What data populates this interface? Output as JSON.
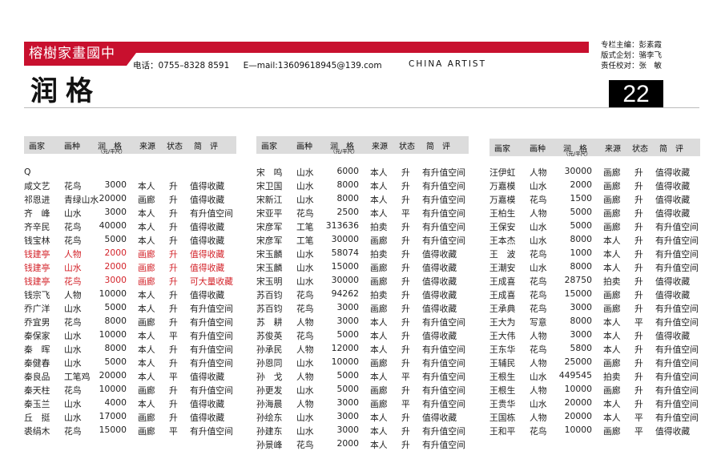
{
  "header": {
    "logo_text": "榕樹家畫國中",
    "phone": "电话：0755–8328 8591",
    "email": "E—mail:13609618945@139.com",
    "brand": "CHINA  ARTIST",
    "credits": [
      "专栏主编：彭素霞",
      "版式企划：骆李飞",
      "责任校对：张　敏"
    ],
    "title": "润格",
    "page_number": "22"
  },
  "table_header": {
    "artist": "画家",
    "genre": "画种",
    "price": "润　格",
    "unit": "（元/平尺）",
    "source": "来源",
    "status": "状态",
    "comment": "简　评"
  },
  "columns": [
    {
      "section": "Q",
      "rows": [
        [
          "咸文艺",
          "花鸟",
          "3000",
          "本人",
          "升",
          "值得收藏"
        ],
        [
          "祁恩进",
          "青绿山水",
          "20000",
          "画廊",
          "升",
          "值得收藏"
        ],
        [
          "齐　峰",
          "山水",
          "3000",
          "本人",
          "升",
          "有升值空间"
        ],
        [
          "齐辛民",
          "花鸟",
          "40000",
          "本人",
          "升",
          "值得收藏"
        ],
        [
          "钱宝林",
          "花鸟",
          "5000",
          "本人",
          "升",
          "值得收藏"
        ],
        [
          "钱建亭",
          "人物",
          "2000",
          "画廊",
          "升",
          "值得收藏",
          "red"
        ],
        [
          "钱建亭",
          "山水",
          "2000",
          "画廊",
          "升",
          "值得收藏",
          "red"
        ],
        [
          "钱建亭",
          "花鸟",
          "3000",
          "画廊",
          "升",
          "可大量收藏",
          "red"
        ],
        [
          "钱宗飞",
          "人物",
          "10000",
          "本人",
          "升",
          "值得收藏"
        ],
        [
          "乔广洋",
          "山水",
          "5000",
          "本人",
          "升",
          "有升值空间"
        ],
        [
          "乔宜男",
          "花鸟",
          "8000",
          "画廊",
          "升",
          "有升值空间"
        ],
        [
          "秦保家",
          "山水",
          "10000",
          "本人",
          "平",
          "有升值空间"
        ],
        [
          "秦　晖",
          "山水",
          "8000",
          "本人",
          "升",
          "有升值空间"
        ],
        [
          "秦健春",
          "山水",
          "5000",
          "本人",
          "升",
          "有升值空间"
        ],
        [
          "秦良品",
          "工笔鸡",
          "20000",
          "本人",
          "平",
          "值得收藏"
        ],
        [
          "秦天柱",
          "花鸟",
          "10000",
          "画廊",
          "升",
          "有升值空间"
        ],
        [
          "秦玉兰",
          "山水",
          "4000",
          "本人",
          "升",
          "值得收藏"
        ],
        [
          "丘　挺",
          "山水",
          "17000",
          "画廊",
          "升",
          "值得收藏"
        ],
        [
          "裘绢木",
          "花鸟",
          "15000",
          "画廊",
          "平",
          "有升值空间"
        ]
      ]
    },
    {
      "section": "",
      "rows": [
        [
          "宋　鸣",
          "山水",
          "6000",
          "本人",
          "升",
          "有升值空间"
        ],
        [
          "宋卫国",
          "山水",
          "8000",
          "本人",
          "升",
          "有升值空间"
        ],
        [
          "宋新江",
          "山水",
          "8000",
          "本人",
          "升",
          "有升值空间"
        ],
        [
          "宋亚平",
          "花鸟",
          "2500",
          "本人",
          "平",
          "有升值空间"
        ],
        [
          "宋彦军",
          "工笔",
          "313636",
          "拍卖",
          "升",
          "有升值空间"
        ],
        [
          "宋彦军",
          "工笔",
          "30000",
          "画廊",
          "升",
          "有升值空间"
        ],
        [
          "宋玉麟",
          "山水",
          "58074",
          "拍卖",
          "升",
          "值得收藏"
        ],
        [
          "宋玉麟",
          "山水",
          "15000",
          "画廊",
          "升",
          "值得收藏"
        ],
        [
          "宋玉明",
          "山水",
          "30000",
          "画廊",
          "升",
          "值得收藏"
        ],
        [
          "苏百钧",
          "花鸟",
          "94262",
          "拍卖",
          "升",
          "值得收藏"
        ],
        [
          "苏百钧",
          "花鸟",
          "3000",
          "画廊",
          "升",
          "值得收藏"
        ],
        [
          "苏　耕",
          "人物",
          "3000",
          "本人",
          "升",
          "有升值空间"
        ],
        [
          "苏俊英",
          "花鸟",
          "5000",
          "本人",
          "升",
          "值得收藏"
        ],
        [
          "孙承民",
          "人物",
          "12000",
          "本人",
          "升",
          "有升值空间"
        ],
        [
          "孙恩同",
          "山水",
          "10000",
          "画廊",
          "升",
          "有升值空间"
        ],
        [
          "孙　戈",
          "人物",
          "5000",
          "本人",
          "平",
          "有升值空间"
        ],
        [
          "孙更发",
          "山水",
          "5000",
          "画廊",
          "升",
          "有升值空间"
        ],
        [
          "孙海晨",
          "人物",
          "3000",
          "画廊",
          "平",
          "有升值空间"
        ],
        [
          "孙绘东",
          "山水",
          "3000",
          "本人",
          "升",
          "值得收藏"
        ],
        [
          "孙建东",
          "山水",
          "3000",
          "本人",
          "升",
          "有升值空间"
        ],
        [
          "孙景峰",
          "花鸟",
          "2000",
          "本人",
          "升",
          "有升值空间"
        ]
      ]
    },
    {
      "section": "",
      "rows": [
        [
          "汪伊虹",
          "人物",
          "30000",
          "画廊",
          "升",
          "值得收藏"
        ],
        [
          "万嘉模",
          "山水",
          "2000",
          "画廊",
          "升",
          "值得收藏"
        ],
        [
          "万嘉模",
          "花鸟",
          "1500",
          "画廊",
          "升",
          "值得收藏"
        ],
        [
          "王柏生",
          "人物",
          "5000",
          "画廊",
          "升",
          "值得收藏"
        ],
        [
          "王保安",
          "山水",
          "5000",
          "画廊",
          "升",
          "有升值空间"
        ],
        [
          "王本杰",
          "山水",
          "8000",
          "本人",
          "升",
          "有升值空间"
        ],
        [
          "王　波",
          "花鸟",
          "1000",
          "本人",
          "升",
          "有升值空间"
        ],
        [
          "王潮安",
          "山水",
          "8000",
          "本人",
          "升",
          "有升值空间"
        ],
        [
          "王成喜",
          "花鸟",
          "28750",
          "拍卖",
          "升",
          "值得收藏"
        ],
        [
          "王成喜",
          "花鸟",
          "15000",
          "画廊",
          "升",
          "值得收藏"
        ],
        [
          "王承典",
          "花鸟",
          "3000",
          "画廊",
          "升",
          "有升值空间"
        ],
        [
          "王大为",
          "写意",
          "8000",
          "本人",
          "平",
          "有升值空间"
        ],
        [
          "王大伟",
          "人物",
          "3000",
          "本人",
          "升",
          "值得收藏"
        ],
        [
          "王东华",
          "花鸟",
          "5800",
          "本人",
          "升",
          "有升值空间"
        ],
        [
          "王辅民",
          "人物",
          "25000",
          "画廊",
          "升",
          "有升值空间"
        ],
        [
          "王根生",
          "山水",
          "449545",
          "拍卖",
          "升",
          "有升值空间"
        ],
        [
          "王根生",
          "人物",
          "10000",
          "画廊",
          "升",
          "有升值空间"
        ],
        [
          "王贵华",
          "山水",
          "20000",
          "本人",
          "升",
          "有升值空间"
        ],
        [
          "王国栋",
          "人物",
          "20000",
          "本人",
          "平",
          "有升值空间"
        ],
        [
          "王和平",
          "花鸟",
          "10000",
          "画廊",
          "平",
          "值得收藏"
        ]
      ]
    }
  ]
}
